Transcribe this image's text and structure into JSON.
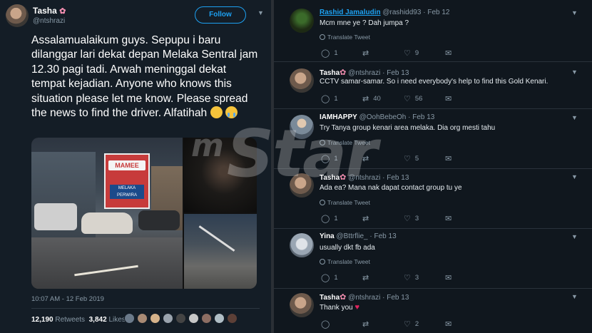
{
  "tweet": {
    "name": "Tasha",
    "handle": "@ntshrazi",
    "follow_label": "Follow",
    "text": "Assalamualaikum guys. Sepupu i baru dilanggar lari dekat depan Melaka Sentral jam 12.30 pagi tadi. Arwah meninggal dekat tempat kejadian. Anyone who knows this situation please let me know. Please spread the news to find the driver. Alfatihah",
    "emoji": [
      "pensive-face",
      "crying-face"
    ],
    "timestamp": "10:07 AM - 12 Feb 2019",
    "retweets_count": "12,190",
    "retweets_label": "Retweets",
    "likes_count": "3,842",
    "likes_label": "Likes",
    "photo_sign_text": "MAMEE",
    "photo_sign_sub": "MELAKA PERWIRA"
  },
  "watermark": {
    "small": "m",
    "big": "Star"
  },
  "replies": [
    {
      "name": "Rashid Jamaludin",
      "handle": "@rashidd93",
      "date": "Feb 12",
      "text": "Mcm mne ye ? Dah jumpa ?",
      "translate": "Translate Tweet",
      "replies": "1",
      "retweets": "",
      "likes": "9"
    },
    {
      "name": "Tasha",
      "handle": "@ntshrazi",
      "date": "Feb 13",
      "text": "CCTV samar-samar. So i need everybody's help to find this Gold Kenari.",
      "translate": "",
      "replies": "1",
      "retweets": "40",
      "likes": "56"
    },
    {
      "name": "IAMHAPPY",
      "handle": "@OohBebeOh",
      "date": "Feb 13",
      "text": "Try Tanya group kenari area melaka. Dia org mesti tahu",
      "translate": "Translate Tweet",
      "replies": "1",
      "retweets": "",
      "likes": "5"
    },
    {
      "name": "Tasha",
      "handle": "@ntshrazi",
      "date": "Feb 13",
      "text": "Ada ea? Mana nak dapat contact group tu ye",
      "translate": "Translate Tweet",
      "replies": "1",
      "retweets": "",
      "likes": "3"
    },
    {
      "name": "Yina",
      "handle": "@Bttrflie_",
      "date": "Feb 13",
      "text": "usually dkt fb ada",
      "translate": "Translate Tweet",
      "replies": "1",
      "retweets": "",
      "likes": "3"
    },
    {
      "name": "Tasha",
      "handle": "@ntshrazi",
      "date": "Feb 13",
      "text": "Thank you",
      "translate": "",
      "replies": "",
      "retweets": "",
      "likes": "2"
    }
  ],
  "icons": {
    "reply": "reply-icon",
    "retweet": "retweet-icon",
    "like": "heart-icon",
    "dm": "envelope-icon",
    "menu": "chevron-down-icon",
    "translate": "globe-icon"
  },
  "colors": {
    "accent": "#1da1f2",
    "background": "#141d26",
    "heart": "#e0245e",
    "flower": "#f48fb1"
  }
}
